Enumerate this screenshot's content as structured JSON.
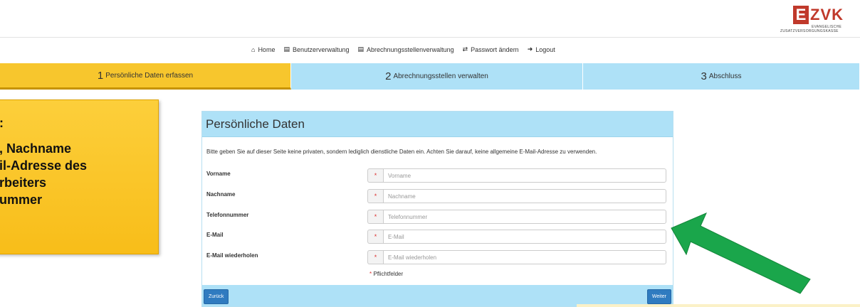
{
  "logo": {
    "initial": "E",
    "rest": "ZVK",
    "line1": "EVANGELISCHE",
    "line2": "ZUSATZVERSORGUNGSKASSE"
  },
  "nav": [
    {
      "icon": "home-icon",
      "glyph": "⌂",
      "label": "Home"
    },
    {
      "icon": "list-icon",
      "glyph": "▤",
      "label": "Benutzerverwaltung"
    },
    {
      "icon": "list-icon",
      "glyph": "▤",
      "label": "Abrechnungsstellenverwaltung"
    },
    {
      "icon": "exchange-icon",
      "glyph": "⇄",
      "label": "Passwort ändern"
    },
    {
      "icon": "logout-icon",
      "glyph": "➜",
      "label": "Logout"
    }
  ],
  "steps": [
    {
      "num": "1",
      "label": "Persönliche Daten erfassen"
    },
    {
      "num": "2",
      "label": "Abrechnungsstellen verwalten"
    },
    {
      "num": "3",
      "label": "Abschluss"
    }
  ],
  "callout": {
    "lines": [
      ":",
      ", Nachname",
      "il-Adresse des",
      "rbeiters",
      "ummer"
    ]
  },
  "panel": {
    "title": "Persönliche Daten",
    "intro": "Bitte geben Sie auf dieser Seite keine privaten, sondern lediglich dienstliche Daten ein. Achten Sie darauf, keine allgemeine E-Mail-Adresse zu verwenden.",
    "fields": [
      {
        "label": "Vorname",
        "placeholder": "Vorname"
      },
      {
        "label": "Nachname",
        "placeholder": "Nachname"
      },
      {
        "label": "Telefonnummer",
        "placeholder": "Telefonnummer"
      },
      {
        "label": "E-Mail",
        "placeholder": "E-Mail"
      },
      {
        "label": "E-Mail wiederholen",
        "placeholder": "E-Mail wiederholen"
      }
    ],
    "required_star": "*",
    "required_note": "Pflichtfelder",
    "back_label": "Zurück",
    "next_label": "Weiter"
  },
  "colors": {
    "step_active": "#f7c62d",
    "step_inactive": "#aee1f7",
    "button": "#2f7bc0",
    "arrow": "#1aa64b",
    "logo": "#c0392b"
  }
}
